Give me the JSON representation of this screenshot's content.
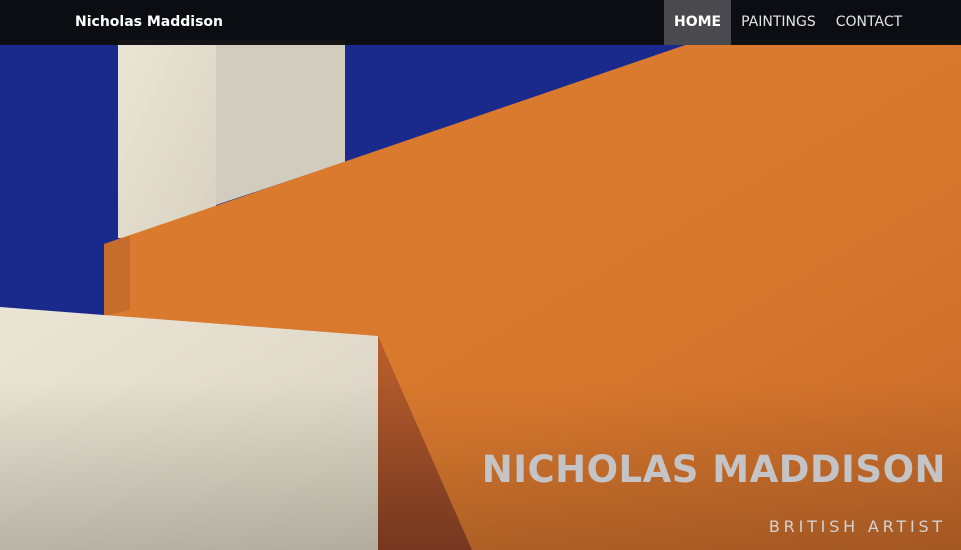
{
  "site": {
    "brand": "Nicholas Maddison"
  },
  "nav": {
    "items": [
      {
        "label": "HOME",
        "active": true
      },
      {
        "label": "PAINTINGS",
        "active": false
      },
      {
        "label": "CONTACT",
        "active": false
      }
    ]
  },
  "hero": {
    "title": "NICHOLAS MADDISON",
    "subtitle": "BRITISH ARTIST",
    "artwork_colors": {
      "blue": "#1a2a8c",
      "orange": "#d8782e",
      "cream": "#e6e0d2",
      "shadow": "#9c4a26"
    }
  }
}
